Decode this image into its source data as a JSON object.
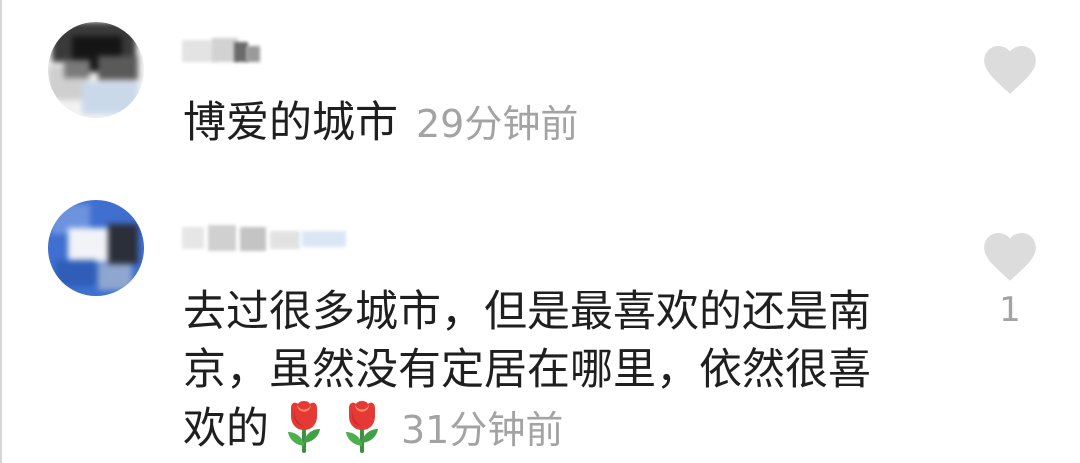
{
  "comments": [
    {
      "text": "博爱的城市",
      "time": "29分钟前",
      "like_icon": "heart-icon"
    },
    {
      "text": "去过很多城市，但是最喜欢的还是南京，虽然没有定居在哪里，依然很喜欢的",
      "emojis": [
        "rose-emoji",
        "rose-emoji"
      ],
      "time": "31分钟前",
      "like_icon": "heart-icon",
      "like_count": "1"
    }
  ],
  "colors": {
    "text": "#1f1f1f",
    "meta": "#a3a3a3",
    "like_icon": "#dcdcdc",
    "rose": "#e53935",
    "leaf": "#43a047"
  }
}
